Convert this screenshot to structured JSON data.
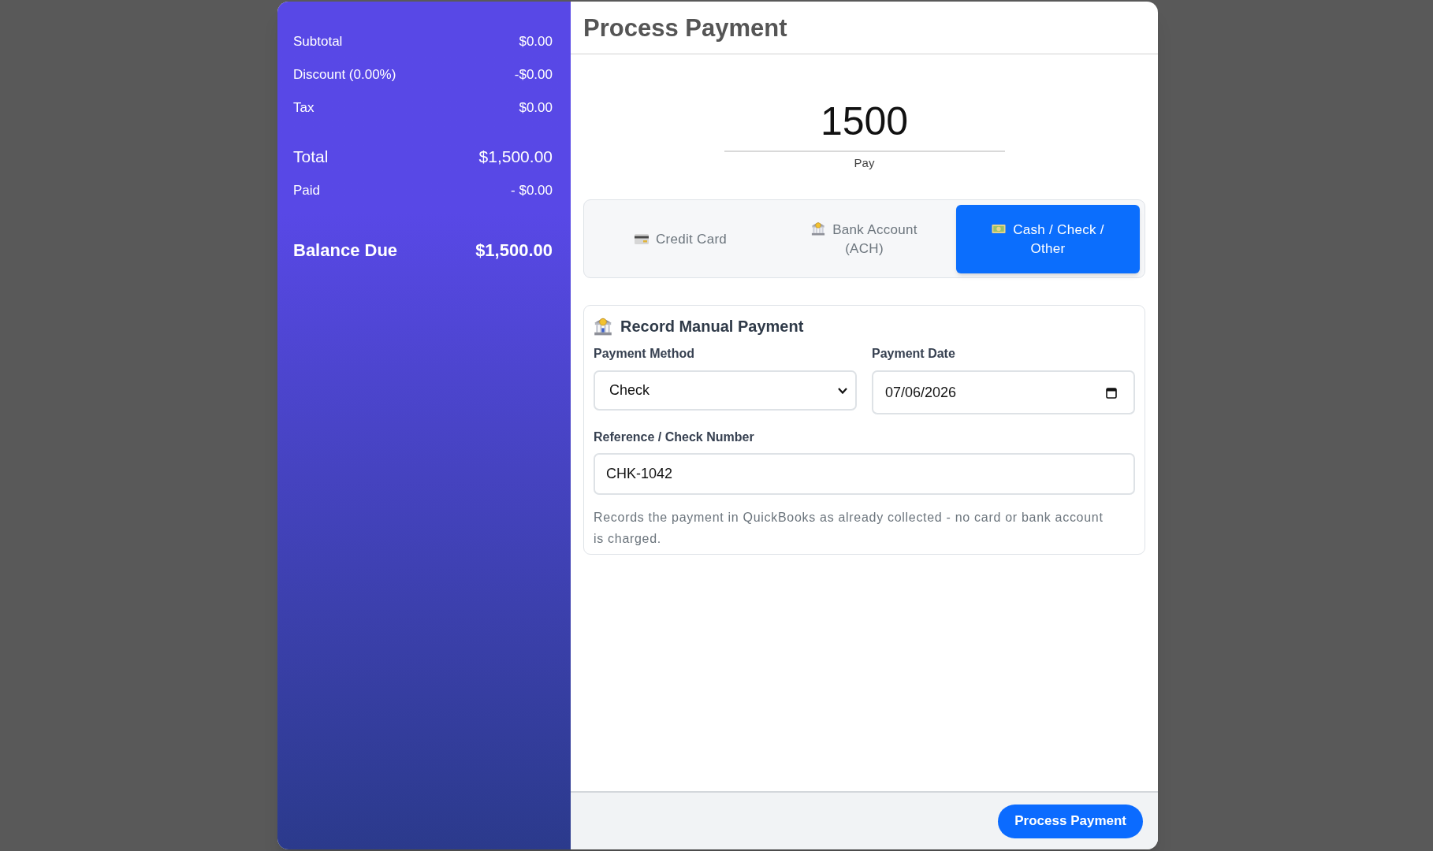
{
  "summary": {
    "rows": [
      {
        "kind": "line",
        "label": "Subtotal",
        "value": "$0.00"
      },
      {
        "kind": "line",
        "label": "Discount (0.00%)",
        "value": "-$0.00"
      },
      {
        "kind": "line",
        "label": "Tax",
        "value": "$0.00"
      },
      {
        "kind": "total",
        "label": "Total",
        "value": "$1,500.00"
      },
      {
        "kind": "line",
        "label": "Paid",
        "value": "- $0.00"
      },
      {
        "kind": "balance",
        "label": "Balance Due",
        "value": "$1,500.00"
      }
    ]
  },
  "header": {
    "title": "Process Payment"
  },
  "amount": {
    "value": "1500",
    "label": "Pay"
  },
  "method_tabs": [
    {
      "kind": "card",
      "label": "Credit Card",
      "selected": false
    },
    {
      "kind": "bank",
      "label": "Bank Account (ACH)",
      "selected": false
    },
    {
      "kind": "cash",
      "label": "Cash / Check / Other",
      "selected": true
    }
  ],
  "manual_payment": {
    "title": "Record Manual Payment",
    "field_rows": [
      [
        {
          "kind": "select",
          "label": "Payment Method",
          "value": "Check"
        },
        {
          "kind": "date",
          "label": "Payment Date",
          "value": "07/06/2026"
        }
      ],
      [
        {
          "kind": "text",
          "label": "Reference / Check Number",
          "value": "CHK-1042"
        }
      ]
    ],
    "note": "Records the payment in QuickBooks as already collected - no card or bank account is charged."
  },
  "footer": {
    "button": "Process Payment"
  }
}
